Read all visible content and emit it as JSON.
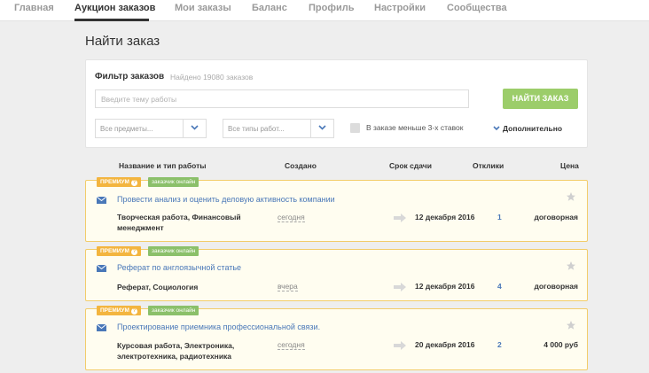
{
  "nav": {
    "items": [
      {
        "label": "Главная",
        "active": false
      },
      {
        "label": "Аукцион заказов",
        "active": true
      },
      {
        "label": "Мои заказы",
        "active": false
      },
      {
        "label": "Баланс",
        "active": false
      },
      {
        "label": "Профиль",
        "active": false
      },
      {
        "label": "Настройки",
        "active": false
      },
      {
        "label": "Сообщества",
        "active": false
      }
    ]
  },
  "page": {
    "title": "Найти заказ"
  },
  "filter": {
    "title": "Фильтр заказов",
    "found": "Найдено 19080 заказов",
    "search_placeholder": "Введите тему работы",
    "find_button": "НАЙТИ ЗАКАЗ",
    "subjects_select": "Все предметы...",
    "types_select": "Все типы работ...",
    "checkbox_label": "В заказе меньше 3-х ставок",
    "more_toggle": "Дополнительно"
  },
  "columns": {
    "name": "Название и тип работы",
    "created": "Создано",
    "deadline": "Срок сдачи",
    "bids": "Отклики",
    "price": "Цена"
  },
  "badges": {
    "premium": "ПРЕМИУМ",
    "premium_help": "?",
    "online": "заказчик онлайн"
  },
  "orders": [
    {
      "title": "Провести анализ и оценить деловую активность компании",
      "types": "Творческая работа, Финансовый менеджмент",
      "created": "сегодня",
      "deadline": "12 декабря 2016",
      "bids": "1",
      "price": "договорная"
    },
    {
      "title": "Реферат по англоязычной статье",
      "types": "Реферат, Социология",
      "created": "вчера",
      "deadline": "12 декабря 2016",
      "bids": "4",
      "price": "договорная"
    },
    {
      "title": "Проектирование приемника профессиональной связи.",
      "types": "Курсовая работа, Электроника, электротехника, радиотехника",
      "created": "сегодня",
      "deadline": "20 декабря 2016",
      "bids": "2",
      "price": "4 000 руб"
    }
  ],
  "colors": {
    "accent_green": "#9ccd6a",
    "link_blue": "#4a78b8",
    "premium_orange": "#f3b53f",
    "card_border": "#f2cc6a"
  }
}
